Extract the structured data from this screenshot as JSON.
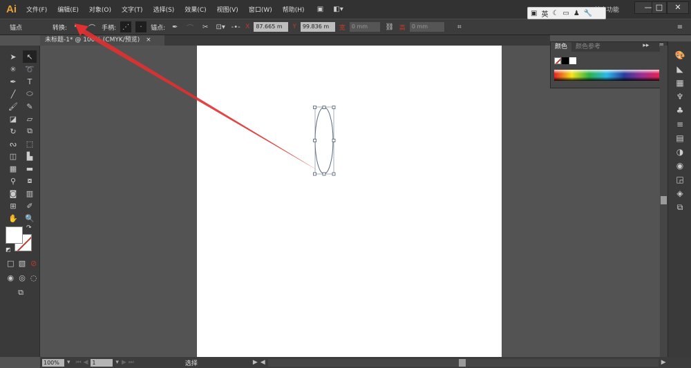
{
  "app": {
    "logo": "Ai"
  },
  "menu": [
    "文件(F)",
    "编辑(E)",
    "对象(O)",
    "文字(T)",
    "选择(S)",
    "效果(C)",
    "视图(V)",
    "窗口(W)",
    "帮助(H)"
  ],
  "workspace": "基本功能",
  "window_controls": {
    "minimize": "—",
    "maximize": "□",
    "close": "✕"
  },
  "ime": {
    "mode": "英"
  },
  "control_bar": {
    "context": "锚点",
    "convert_label": "转换:",
    "handles_label": "手柄:",
    "anchor_label": "锚点:",
    "x_label": "X",
    "x_value": "87.665 m",
    "y_label": "Y",
    "y_value": "99.836 m",
    "w_label": "宽",
    "w_value": "0 mm",
    "h_label": "高",
    "h_value": "0 mm"
  },
  "document_tab": {
    "title": "未标题-1* @ 100% (CMYK/预览)",
    "close": "×"
  },
  "color_panel": {
    "tabs": [
      "颜色",
      "颜色参考"
    ]
  },
  "status_bar": {
    "zoom": "100%",
    "page": "1",
    "tool": "选择"
  },
  "colors": {
    "accent": "#e8a23a",
    "arrow": "#e03030",
    "artboard": "#ffffff"
  }
}
